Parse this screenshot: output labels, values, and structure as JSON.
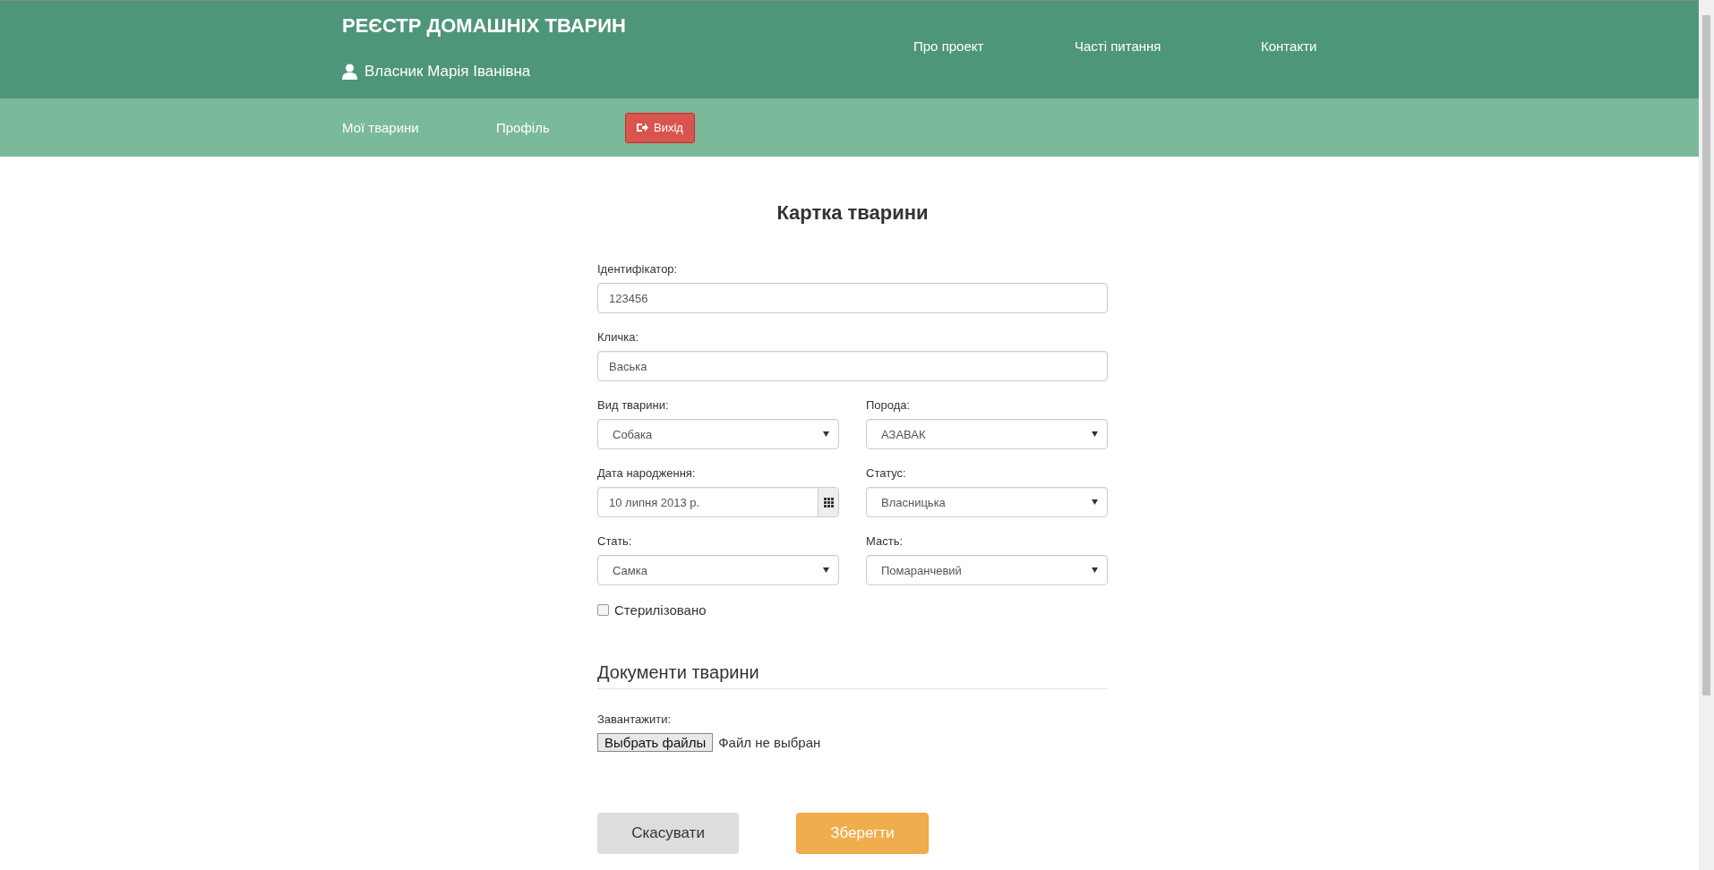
{
  "header": {
    "title": "РЕЄСТР ДОМАШНІХ ТВАРИН",
    "user": "Власник Марія Іванівна",
    "nav": [
      "Про проект",
      "Часті питання",
      "Контакти"
    ]
  },
  "subnav": {
    "items": [
      "Мої тварини",
      "Профіль"
    ],
    "logout": "Вихід"
  },
  "card": {
    "title": "Картка тварини",
    "rows": [
      [
        {
          "kind": "text",
          "label": "Ідентифікатор:",
          "value": "123456"
        }
      ],
      [
        {
          "kind": "text",
          "label": "Кличка:",
          "value": "Васька"
        }
      ],
      [
        {
          "kind": "select",
          "label": "Вид тварини:",
          "value": "Собака"
        },
        {
          "kind": "select",
          "label": "Порода:",
          "value": "АЗАВАК"
        }
      ],
      [
        {
          "kind": "date",
          "label": "Дата народження:",
          "value": "10 липня 2013 р."
        },
        {
          "kind": "select",
          "label": "Статус:",
          "value": "Власницька"
        }
      ],
      [
        {
          "kind": "select",
          "label": "Стать:",
          "value": "Самка"
        },
        {
          "kind": "select",
          "label": "Масть:",
          "value": "Помаранчевий"
        }
      ]
    ],
    "checkbox": {
      "label": "Стерилізовано",
      "checked": false
    },
    "documents": {
      "heading": "Документи тварини",
      "upload_label": "Завантажити:",
      "file_button": "Выбрать файлы",
      "file_status": "Файл не выбран"
    },
    "buttons": [
      {
        "label": "Скасувати",
        "kind": "secondary"
      },
      {
        "label": "Зберегти",
        "kind": "primary"
      }
    ]
  }
}
